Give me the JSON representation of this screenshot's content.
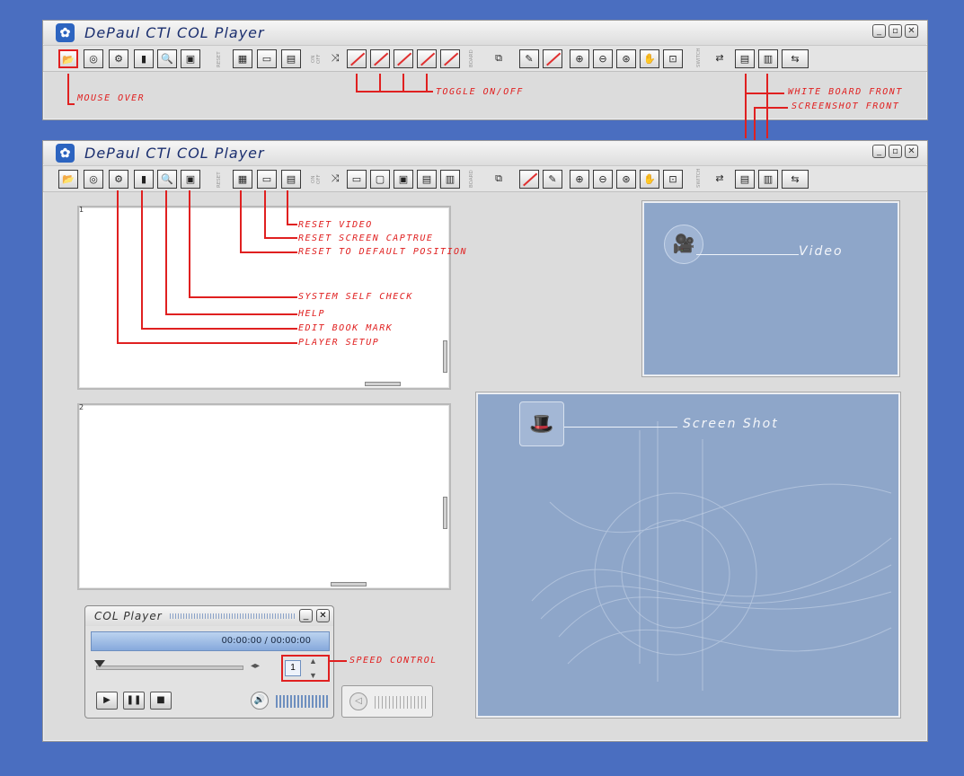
{
  "window_title": "DePaul CTI  COL Player",
  "title_controls": {
    "minimize": "_",
    "restore": "▫",
    "close": "✕"
  },
  "separators": {
    "reset": "RESET",
    "onoff": "ON OFF",
    "board": "BOARD",
    "switch": "SWITCH"
  },
  "panels": {
    "top_number": "1",
    "bottom_number": "2"
  },
  "video_label": "Video",
  "screenshot_label": "Screen Shot",
  "player": {
    "title": "COL Player",
    "time": "00:00:00 / 00:00:00",
    "speed": "1",
    "minimize": "_",
    "close": "✕"
  },
  "annotations": {
    "mouse_over": "MOUSE OVER",
    "toggle": "TOGGLE ON/OFF",
    "white_board_front": "WHITE BOARD FRONT",
    "screenshot_front": "SCREENSHOT FRONT",
    "reset_video": "RESET VIDEO",
    "reset_screen_capture": "RESET SCREEN CAPTRUE",
    "reset_default": "RESET TO DEFAULT POSITION",
    "system_self_check": "SYSTEM SELF CHECK",
    "help": "HELP",
    "edit_book_mark": "EDIT BOOK MARK",
    "player_setup": "PLAYER SETUP",
    "speed_control": "SPEED CONTROL"
  },
  "colors": {
    "background": "#4a6ec0",
    "annotation": "#e02020",
    "panel_blue": "#8ea6c9"
  },
  "icons": [
    "folder-icon",
    "disc-icon",
    "setup-icon",
    "bookmark-icon",
    "help-icon",
    "self-check-icon",
    "layout-icon",
    "screen-capture-icon",
    "video-reset-icon",
    "camera-icon",
    "whiteboard-icon",
    "speaker-icon"
  ]
}
